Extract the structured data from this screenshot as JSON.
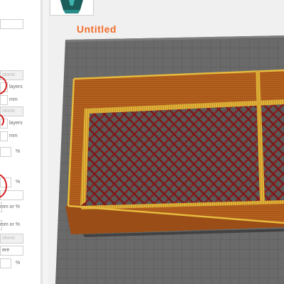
{
  "window": {
    "document_title": "Untitled"
  },
  "settings_panel": {
    "fields": [
      {
        "id": "field-1",
        "value": "",
        "unit": ""
      },
      {
        "id": "field-2",
        "value": "otonic",
        "unit": "",
        "greyed": true
      },
      {
        "id": "field-3",
        "value": "",
        "unit": "layers"
      },
      {
        "id": "field-4",
        "value": "",
        "unit": "mm"
      },
      {
        "id": "field-5",
        "value": "otonic",
        "unit": "",
        "greyed": true
      },
      {
        "id": "field-6",
        "value": "",
        "unit": "layers"
      },
      {
        "id": "field-7",
        "value": "",
        "unit": "mm"
      },
      {
        "id": "field-8",
        "value": "",
        "unit": "%"
      },
      {
        "id": "field-9",
        "value": "",
        "unit": "%"
      },
      {
        "id": "field-10",
        "value": "",
        "unit": ""
      },
      {
        "id": "field-11",
        "value": "",
        "unit": "mm or %"
      },
      {
        "id": "field-12",
        "value": "",
        "unit": "mm or %"
      },
      {
        "id": "field-13",
        "value": "otonic",
        "unit": "",
        "greyed": true
      },
      {
        "id": "field-14",
        "value": "ere",
        "unit": ""
      },
      {
        "id": "field-15",
        "value": "",
        "unit": "%"
      }
    ]
  },
  "viewport": {
    "plate_icon": "build-plate-icon",
    "model": "rectangular-box-with-diagonal-grid-infill"
  },
  "colors": {
    "accent": "#f26d2a",
    "perimeter": "#b05a22",
    "infill": "#8a1f1f",
    "bed": "#6d6d6d",
    "annotation": "#d51e1e"
  }
}
